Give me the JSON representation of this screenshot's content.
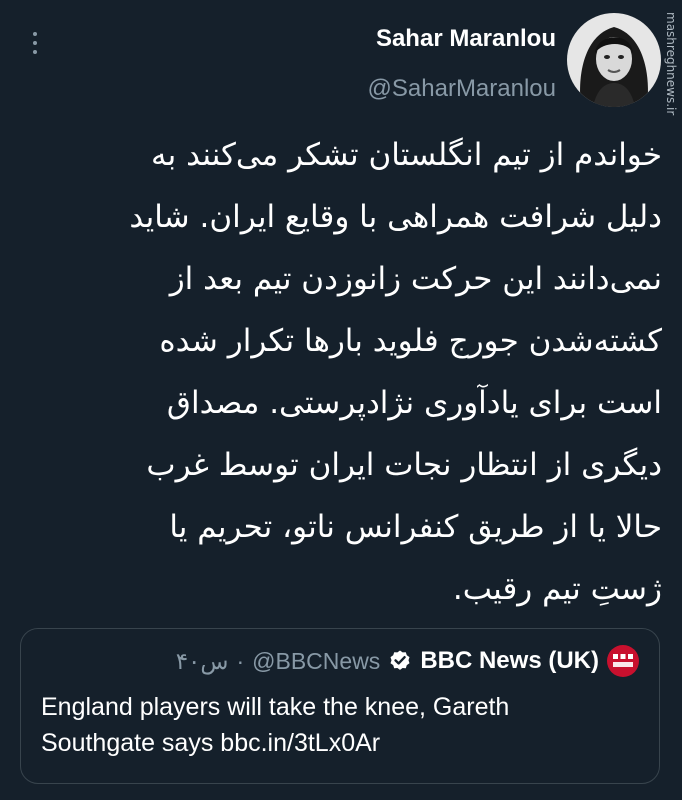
{
  "tweet": {
    "author_name": "Sahar Maranlou",
    "author_handle": "@SaharMaranlou",
    "more_icon": "more-vertical-icon",
    "text_lines": [
      "خواندم از تیم انگلستان تشکر می‌کنند به",
      "دلیل شرافت همراهی با وقایع ایران. شاید",
      "نمی‌دانند این حرکت زانوزدن تیم بعد از",
      "کشته‌شدن جورج فلوید بارها تکرار شده",
      "است برای یادآوری نژادپرستی. مصداق",
      "دیگری از انتظار نجات ایران توسط غرب",
      "حالا یا از طریق کنفرانس ناتو، تحریم یا",
      "ژستِ تیم رقیب."
    ]
  },
  "watermark": "mashreghnews.ir",
  "quote": {
    "name": "BBC News (UK)",
    "handle": "@BBCNews",
    "separator": "·",
    "time": "۴۰س",
    "text_line1": "England players will take the knee, Gareth",
    "text_line2": "Southgate says bbc.in/3tLx0Ar",
    "verified_icon": "verified-badge-icon",
    "brand_color": "#c8102e"
  },
  "colors": {
    "background": "#15202b",
    "secondary_text": "#8899a6",
    "border": "#38444d",
    "verified": "#ffffff"
  }
}
